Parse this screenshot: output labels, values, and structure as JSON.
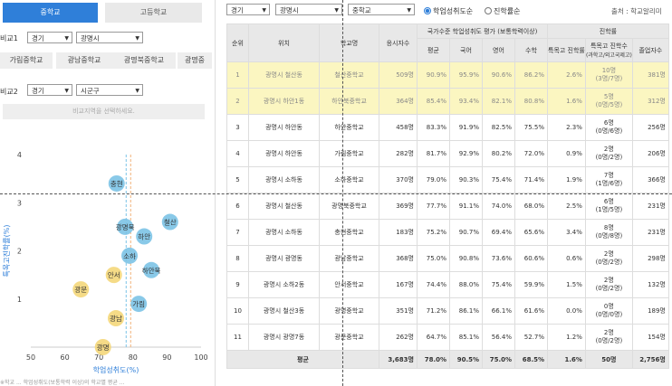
{
  "left": {
    "tabs": [
      "중학교",
      "고등학교"
    ],
    "compare1": {
      "label": "비교1",
      "province": "경기",
      "city": "광명시"
    },
    "schools": [
      "가림중학교",
      "광남중학교",
      "광명북중학교",
      "광명중"
    ],
    "compare2": {
      "label": "비교2",
      "province": "경기",
      "city": "시군구"
    },
    "region_prompt": "비교지역을 선택하세요.",
    "footnote": "※학교 ... 학업성취도(보통학력 이상)의 학교별 평균 ..."
  },
  "filters": {
    "province": "경기",
    "city": "광명시",
    "level": "중학교",
    "radio_selected": "학업성취도순",
    "radio_other": "진학률순",
    "source": "출처 : 학교알리미"
  },
  "table": {
    "headers": {
      "rank": "순위",
      "location": "위치",
      "school": "학교명",
      "examinees": "응시자수",
      "achievement_group": "국가수준 학업성취도 평가 (보통학력이상)",
      "avg": "평균",
      "korean": "국어",
      "english": "영어",
      "math": "수학",
      "admission_group": "진학률",
      "special_rate": "특목고 진학률",
      "special_count": "특목고 진학수",
      "special_count_sub": "(과학고/외고국제고)",
      "graduates": "졸업자수"
    },
    "rows": [
      {
        "rank": "1",
        "location": "광명시 철산동",
        "school": "철산중학교",
        "examinees": "509명",
        "avg": "90.9%",
        "korean": "95.9%",
        "english": "90.6%",
        "math": "86.2%",
        "special_rate": "2.6%",
        "count": "10명",
        "count_sub": "(3명/7명)",
        "graduates": "381명",
        "highlight": true
      },
      {
        "rank": "2",
        "location": "광명시 하안1동",
        "school": "하안북중학교",
        "examinees": "364명",
        "avg": "85.4%",
        "korean": "93.4%",
        "english": "82.1%",
        "math": "80.8%",
        "special_rate": "1.6%",
        "count": "5명",
        "count_sub": "(0명/5명)",
        "graduates": "312명",
        "highlight": true
      },
      {
        "rank": "3",
        "location": "광명시 하안동",
        "school": "하안중학교",
        "examinees": "458명",
        "avg": "83.3%",
        "korean": "91.9%",
        "english": "82.5%",
        "math": "75.5%",
        "special_rate": "2.3%",
        "count": "6명",
        "count_sub": "(0명/6명)",
        "graduates": "256명",
        "highlight": false
      },
      {
        "rank": "4",
        "location": "광명시 하안동",
        "school": "가림중학교",
        "examinees": "282명",
        "avg": "81.7%",
        "korean": "92.9%",
        "english": "80.2%",
        "math": "72.0%",
        "special_rate": "0.9%",
        "count": "2명",
        "count_sub": "(0명/2명)",
        "graduates": "206명",
        "highlight": false
      },
      {
        "rank": "5",
        "location": "광명시 소하동",
        "school": "소하중학교",
        "examinees": "370명",
        "avg": "79.0%",
        "korean": "90.3%",
        "english": "75.4%",
        "math": "71.4%",
        "special_rate": "1.9%",
        "count": "7명",
        "count_sub": "(1명/6명)",
        "graduates": "366명",
        "highlight": false
      },
      {
        "rank": "6",
        "location": "광명시 철산동",
        "school": "광명북중학교",
        "examinees": "369명",
        "avg": "77.7%",
        "korean": "91.1%",
        "english": "74.0%",
        "math": "68.0%",
        "special_rate": "2.5%",
        "count": "6명",
        "count_sub": "(1명/5명)",
        "graduates": "231명",
        "highlight": false
      },
      {
        "rank": "7",
        "location": "광명시 소하동",
        "school": "충현중학교",
        "examinees": "183명",
        "avg": "75.2%",
        "korean": "90.7%",
        "english": "69.4%",
        "math": "65.6%",
        "special_rate": "3.4%",
        "count": "8명",
        "count_sub": "(0명/8명)",
        "graduates": "231명",
        "highlight": false
      },
      {
        "rank": "8",
        "location": "광명시 광명동",
        "school": "광남중학교",
        "examinees": "368명",
        "avg": "75.0%",
        "korean": "90.8%",
        "english": "73.6%",
        "math": "60.6%",
        "special_rate": "0.6%",
        "count": "2명",
        "count_sub": "(0명/2명)",
        "graduates": "298명",
        "highlight": false
      },
      {
        "rank": "9",
        "location": "광명시 소하2동",
        "school": "안서중학교",
        "examinees": "167명",
        "avg": "74.4%",
        "korean": "88.0%",
        "english": "75.4%",
        "math": "59.9%",
        "special_rate": "1.5%",
        "count": "2명",
        "count_sub": "(0명/2명)",
        "graduates": "132명",
        "highlight": false
      },
      {
        "rank": "10",
        "location": "광명시 철산3동",
        "school": "광명중학교",
        "examinees": "351명",
        "avg": "71.2%",
        "korean": "86.1%",
        "english": "66.1%",
        "math": "61.6%",
        "special_rate": "0.0%",
        "count": "0명",
        "count_sub": "(0명/0명)",
        "graduates": "189명",
        "highlight": false
      },
      {
        "rank": "11",
        "location": "광명시 광명7동",
        "school": "광문중학교",
        "examinees": "262명",
        "avg": "64.7%",
        "korean": "85.1%",
        "english": "56.4%",
        "math": "52.7%",
        "special_rate": "1.2%",
        "count": "2명",
        "count_sub": "(0명/2명)",
        "graduates": "154명",
        "highlight": false
      }
    ],
    "total": {
      "label": "평균",
      "examinees": "3,683명",
      "avg": "78.0%",
      "korean": "90.5%",
      "english": "75.0%",
      "math": "68.5%",
      "special_rate": "1.6%",
      "count": "50명",
      "graduates": "2,756명"
    }
  },
  "chart_data": {
    "type": "scatter",
    "xlabel": "학업성취도(%)",
    "ylabel": "특목고진학률(%)",
    "xlim": [
      50,
      100
    ],
    "ylim": [
      0,
      4
    ],
    "xticks": [
      50,
      60,
      70,
      80,
      90,
      100
    ],
    "yticks": [
      1,
      2,
      3,
      4
    ],
    "ref_lines": {
      "x": 78.0,
      "y": 1.6
    },
    "colors": {
      "group_a": "#7cc3e6",
      "group_b": "#f4d77a"
    },
    "points": [
      {
        "label": "철산",
        "x": 90.9,
        "y": 2.6,
        "group": "a"
      },
      {
        "label": "하안북",
        "x": 85.4,
        "y": 1.6,
        "group": "a"
      },
      {
        "label": "하안",
        "x": 83.3,
        "y": 2.3,
        "group": "a"
      },
      {
        "label": "가림",
        "x": 81.7,
        "y": 0.9,
        "group": "a"
      },
      {
        "label": "소하",
        "x": 79.0,
        "y": 1.9,
        "group": "a"
      },
      {
        "label": "광명북",
        "x": 77.7,
        "y": 2.5,
        "group": "a"
      },
      {
        "label": "충현",
        "x": 75.2,
        "y": 3.4,
        "group": "a"
      },
      {
        "label": "광남",
        "x": 75.0,
        "y": 0.6,
        "group": "b"
      },
      {
        "label": "안서",
        "x": 74.4,
        "y": 1.5,
        "group": "b"
      },
      {
        "label": "광명",
        "x": 71.2,
        "y": 0.0,
        "group": "b"
      },
      {
        "label": "광문",
        "x": 64.7,
        "y": 1.2,
        "group": "b"
      }
    ]
  }
}
